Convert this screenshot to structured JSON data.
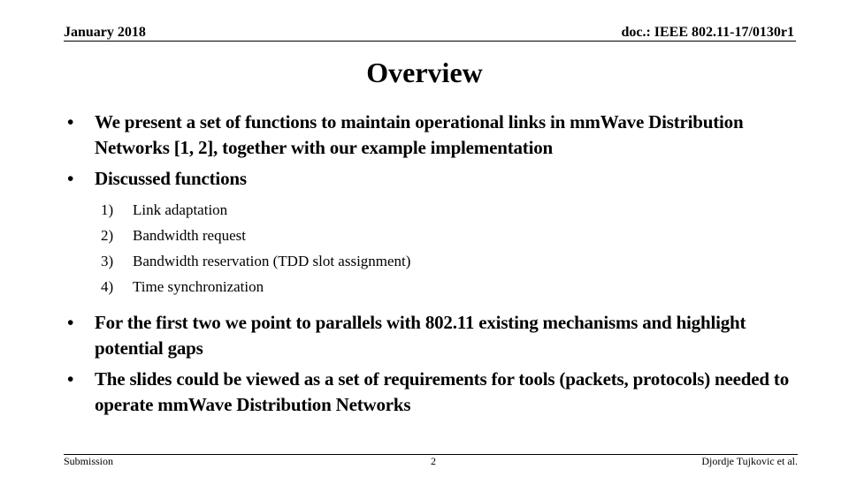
{
  "header": {
    "date": "January 2018",
    "doc_id": "doc.: IEEE 802.11-17/0130r1"
  },
  "slide": {
    "title": "Overview",
    "bullets": [
      {
        "text": "We present a set of functions to maintain operational links in mmWave Distribution Networks [1, 2], together with our example implementation"
      },
      {
        "text": "Discussed functions"
      },
      {
        "text": "For the first two we point to parallels with 802.11 existing mechanisms and highlight potential gaps"
      },
      {
        "text": "The slides could be viewed as a set of requirements for tools (packets, protocols) needed to operate mmWave Distribution Networks"
      }
    ],
    "bullet_glyph": "•",
    "functions": [
      {
        "num": "1)",
        "text": "Link adaptation"
      },
      {
        "num": "2)",
        "text": "Bandwidth request"
      },
      {
        "num": "3)",
        "text": "Bandwidth reservation (TDD slot assignment)"
      },
      {
        "num": "4)",
        "text": "Time synchronization"
      }
    ]
  },
  "footer": {
    "left": "Submission",
    "page": "2",
    "author": "Djordje Tujkovic et al."
  }
}
